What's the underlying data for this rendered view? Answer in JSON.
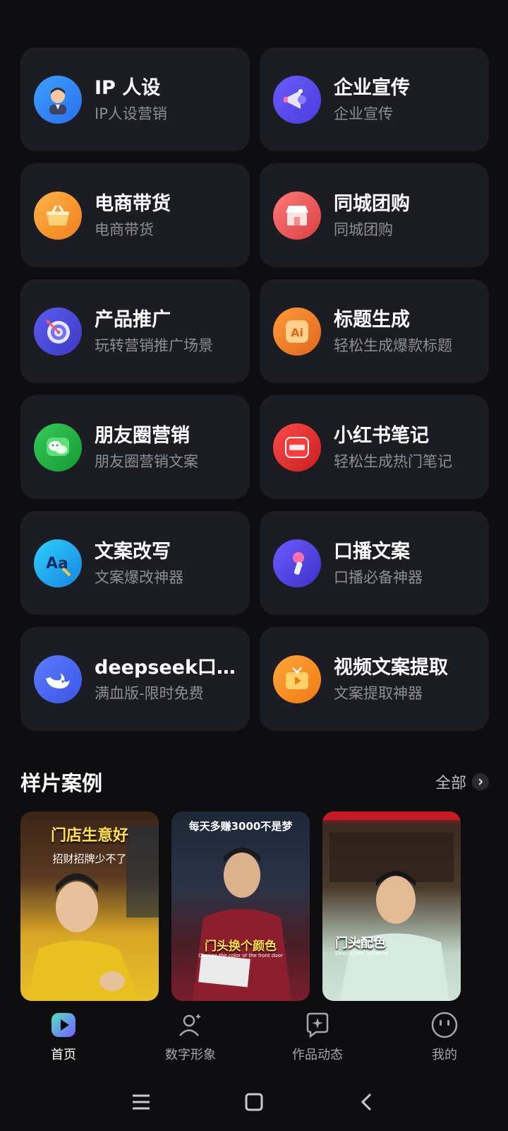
{
  "features": [
    {
      "title": "IP 人设",
      "sub": "IP人设营销",
      "icon": "ip-persona-icon"
    },
    {
      "title": "企业宣传",
      "sub": "企业宣传",
      "icon": "megaphone-icon"
    },
    {
      "title": "电商带货",
      "sub": "电商带货",
      "icon": "shopping-basket-icon"
    },
    {
      "title": "同城团购",
      "sub": "同城团购",
      "icon": "storefront-icon"
    },
    {
      "title": "产品推广",
      "sub": "玩转营销推广场景",
      "icon": "target-dart-icon"
    },
    {
      "title": "标题生成",
      "sub": "轻松生成爆款标题",
      "icon": "ai-icon"
    },
    {
      "title": "朋友圈营销",
      "sub": "朋友圈营销文案",
      "icon": "wechat-icon"
    },
    {
      "title": "小红书笔记",
      "sub": "轻松生成热门笔记",
      "icon": "xiaohongshu-icon"
    },
    {
      "title": "文案改写",
      "sub": "文案爆改神器",
      "icon": "text-rewrite-icon"
    },
    {
      "title": "口播文案",
      "sub": "口播必备神器",
      "icon": "microphone-icon"
    },
    {
      "title": "deepseek口…",
      "sub": "满血版-限时免费",
      "icon": "deepseek-whale-icon"
    },
    {
      "title": "视频文案提取",
      "sub": "文案提取神器",
      "icon": "tv-play-icon"
    }
  ],
  "samples_section": {
    "title": "样片案例",
    "see_all": "全部"
  },
  "samples": [
    {
      "caption": "门店生意好",
      "sub": "招财招牌少不了"
    },
    {
      "top": "每天多赚3000不是梦",
      "caption": "门头换个颜色",
      "sub": "Change the color of the front door"
    },
    {
      "caption": "门头配色",
      "sub": "Door color scheme"
    }
  ],
  "tabs": [
    {
      "label": "首页",
      "icon": "home-play-icon",
      "active": true
    },
    {
      "label": "数字形象",
      "icon": "digital-avatar-icon",
      "active": false
    },
    {
      "label": "作品动态",
      "icon": "works-chat-icon",
      "active": false
    },
    {
      "label": "我的",
      "icon": "profile-face-icon",
      "active": false
    }
  ],
  "colors": {
    "background": "#0e0e11",
    "card": "#1c1d22",
    "subtext": "#8d8e94",
    "accent_teal": "#4fe3c1",
    "accent_purple": "#7b5cff"
  }
}
